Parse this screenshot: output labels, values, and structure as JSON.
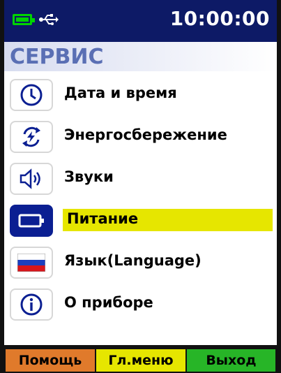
{
  "status": {
    "time": "10:00:00"
  },
  "screen": {
    "title": "СЕРВИС"
  },
  "menu": {
    "items": [
      {
        "label": "Дата и время",
        "icon": "clock-icon"
      },
      {
        "label": "Энергосбережение",
        "icon": "energy-saving-icon"
      },
      {
        "label": "Звуки",
        "icon": "speaker-icon"
      },
      {
        "label": "Питание",
        "icon": "battery-icon",
        "selected": true
      },
      {
        "label": "Язык(Language)",
        "icon": "russian-flag-icon"
      },
      {
        "label": "О приборе",
        "icon": "info-icon"
      }
    ]
  },
  "footer": {
    "help": "Помощь",
    "main_menu": "Гл.меню",
    "exit": "Выход"
  },
  "colors": {
    "statusbar": "#0d1a66",
    "title": "#5a6fb4",
    "selection": "#e6e600",
    "help": "#e07a2b",
    "exit": "#27b527"
  }
}
